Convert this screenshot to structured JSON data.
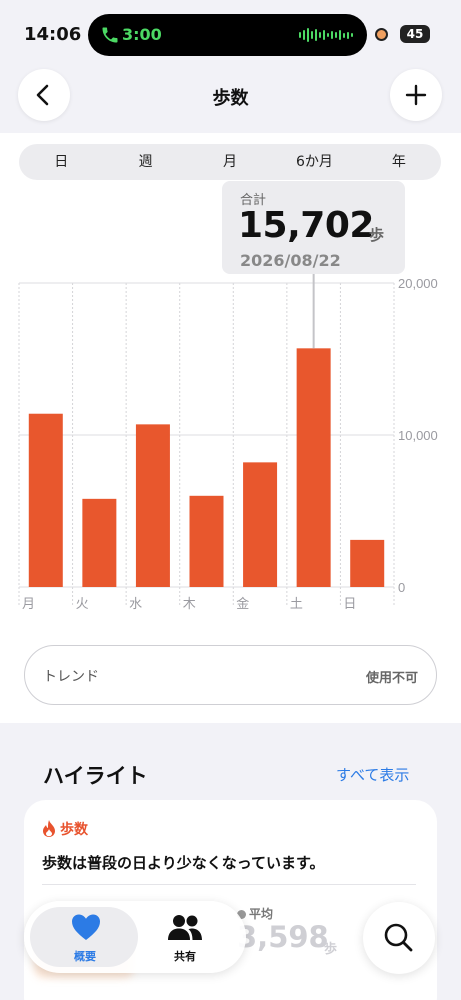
{
  "status_bar": {
    "time": "14:06",
    "call_time": "3:00",
    "battery": "45"
  },
  "header": {
    "title": "歩数"
  },
  "period_tabs": [
    "日",
    "週",
    "月",
    "6か月",
    "年"
  ],
  "selected_period": "週",
  "tooltip": {
    "label": "合計",
    "value": "15,702",
    "unit": "歩",
    "date": "2026/08/22"
  },
  "chart_data": {
    "type": "bar",
    "categories": [
      "月",
      "火",
      "水",
      "木",
      "金",
      "土",
      "日"
    ],
    "values": [
      11400,
      5800,
      10700,
      6000,
      8200,
      15702,
      3100
    ],
    "y_ticks": [
      "0",
      "10,000",
      "20,000"
    ],
    "ylim": [
      0,
      20000
    ],
    "highlighted": "土",
    "color": "#e8572d",
    "grid": true
  },
  "trend": {
    "label": "トレンド",
    "status": "使用不可"
  },
  "highlights": {
    "title": "ハイライト",
    "show_all": "すべて表示",
    "card": {
      "category": "歩数",
      "text": "歩数は普段の日より少なくなっています。",
      "avg_label": "平均",
      "avg_value": "3,598",
      "avg_unit": "歩"
    }
  },
  "tabbar": {
    "summary": {
      "label": "概要",
      "icon": "heart-icon"
    },
    "share": {
      "label": "共有",
      "icon": "people-icon"
    }
  },
  "colors": {
    "accent": "#2c7be5",
    "bar": "#e8572d"
  }
}
